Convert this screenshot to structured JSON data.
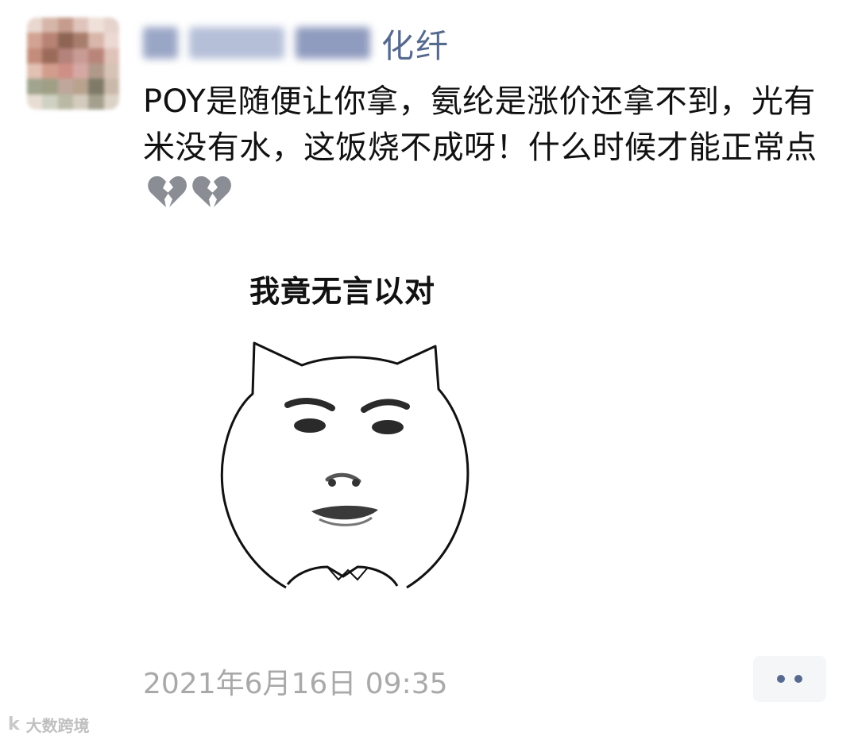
{
  "post": {
    "author_suffix": "化纤",
    "body": "POY是随便让你拿，氨纶是涨价还拿不到，光有米没有水，这饭烧不成呀！什么时候才能正常点",
    "emoji_icons": [
      "broken-heart-icon",
      "broken-heart-icon"
    ],
    "meme_caption": "我竟无言以对",
    "timestamp": "2021年6月16日 09:35"
  },
  "actions": {
    "more_icon": "ellipsis-icon"
  },
  "watermark": {
    "logo_text": "k",
    "text": "大数跨境"
  },
  "colors": {
    "author": "#55698f",
    "timestamp": "#a9a9a9",
    "more_bg": "#f5f6f8"
  }
}
